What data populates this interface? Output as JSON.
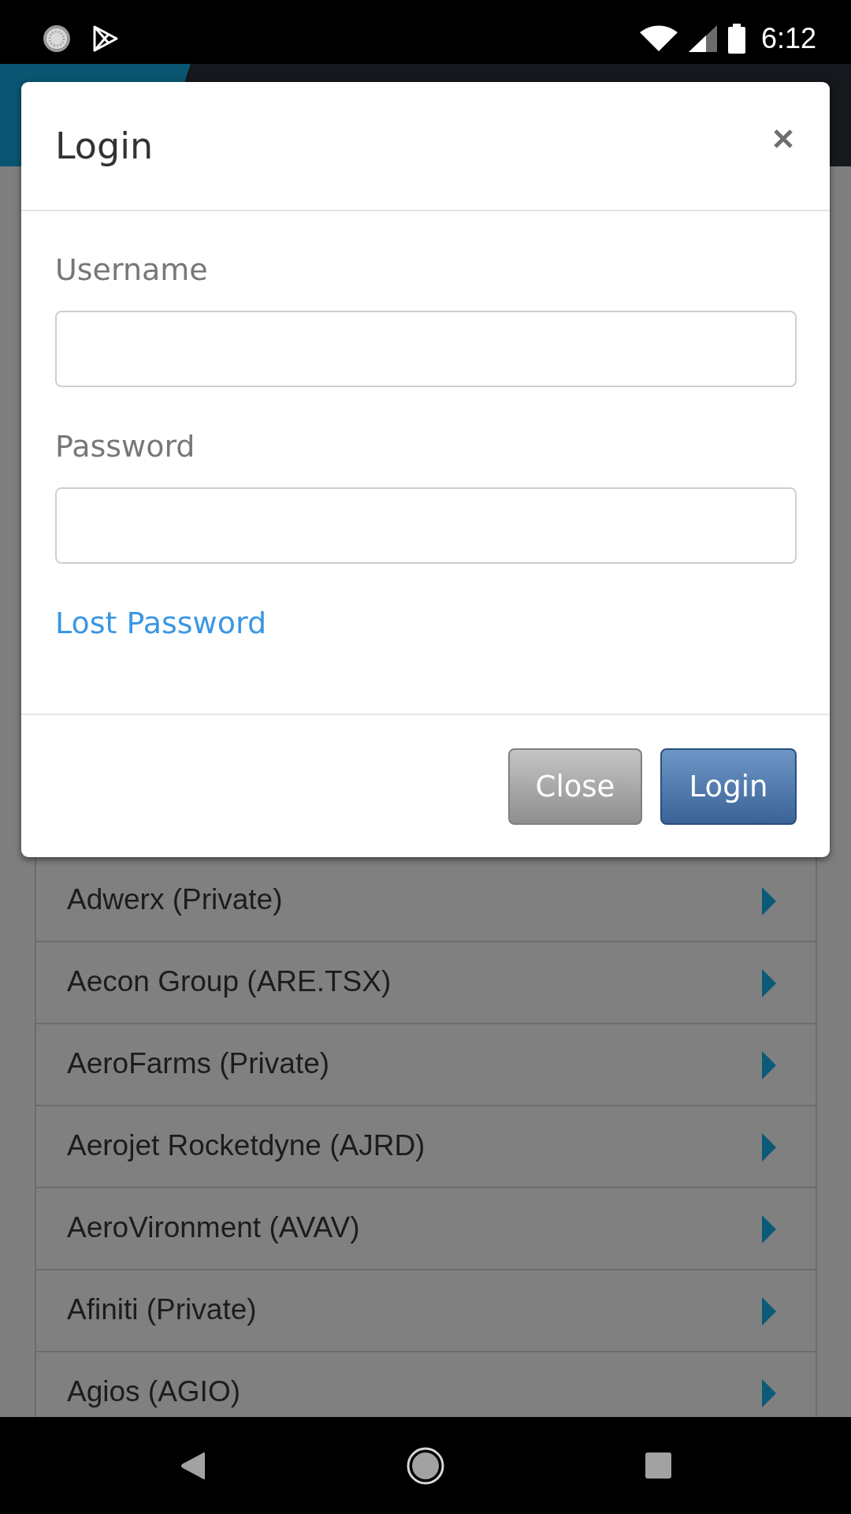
{
  "status_bar": {
    "time": "6:12"
  },
  "dialog": {
    "title": "Login",
    "fields": [
      {
        "label": "Username"
      },
      {
        "label": "Password"
      }
    ],
    "link": "Lost Password",
    "buttons": [
      {
        "label": "Close",
        "kind": "secondary"
      },
      {
        "label": "Login",
        "kind": "primary"
      }
    ]
  },
  "companies": [
    "Adwerx (Private)",
    "Aecon Group (ARE.TSX)",
    "AeroFarms (Private)",
    "Aerojet Rocketdyne (AJRD)",
    "AeroVironment (AVAV)",
    "Afiniti (Private)",
    "Agios (AGIO)"
  ]
}
